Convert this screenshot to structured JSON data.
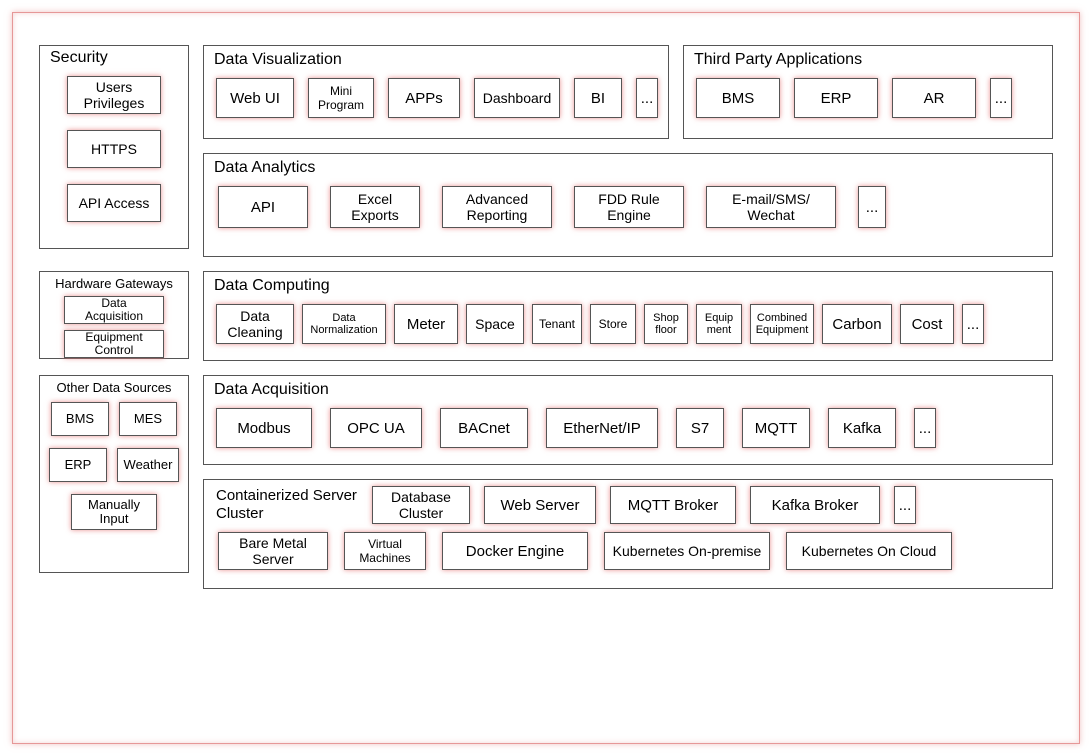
{
  "security": {
    "title": "Security",
    "items": [
      "Users Privileges",
      "HTTPS",
      "API Access"
    ]
  },
  "hardware_gateways": {
    "title": "Hardware Gateways",
    "items": [
      "Data Acquisition",
      "Equipment Control"
    ]
  },
  "other_data_sources": {
    "title": "Other Data Sources",
    "row1": [
      "BMS",
      "MES"
    ],
    "row2": [
      "ERP",
      "Weather"
    ],
    "row3": [
      "Manually Input"
    ]
  },
  "data_visualization": {
    "title": "Data Visualization",
    "items": [
      "Web UI",
      "Mini Program",
      "APPs",
      "Dashboard",
      "BI",
      "..."
    ]
  },
  "third_party": {
    "title": "Third Party Applications",
    "items": [
      "BMS",
      "ERP",
      "AR",
      "..."
    ]
  },
  "data_analytics": {
    "title": "Data Analytics",
    "items": [
      "API",
      "Excel Exports",
      "Advanced Reporting",
      "FDD Rule Engine",
      "E-mail/SMS/ Wechat",
      "..."
    ]
  },
  "data_computing": {
    "title": "Data Computing",
    "items": [
      "Data Cleaning",
      "Data Normalization",
      "Meter",
      "Space",
      "Tenant",
      "Store",
      "Shop floor",
      "Equip ment",
      "Combined Equipment",
      "Carbon",
      "Cost",
      "..."
    ]
  },
  "data_acquisition": {
    "title": "Data Acquisition",
    "items": [
      "Modbus",
      "OPC UA",
      "BACnet",
      "EtherNet/IP",
      "S7",
      "MQTT",
      "Kafka",
      "..."
    ]
  },
  "server_cluster": {
    "title": "Containerized Server Cluster",
    "row1": [
      "Database Cluster",
      "Web Server",
      "MQTT Broker",
      "Kafka  Broker",
      "..."
    ],
    "row2": [
      "Bare Metal Server",
      "Virtual Machines",
      "Docker Engine",
      "Kubernetes On-premise",
      "Kubernetes On Cloud"
    ]
  }
}
